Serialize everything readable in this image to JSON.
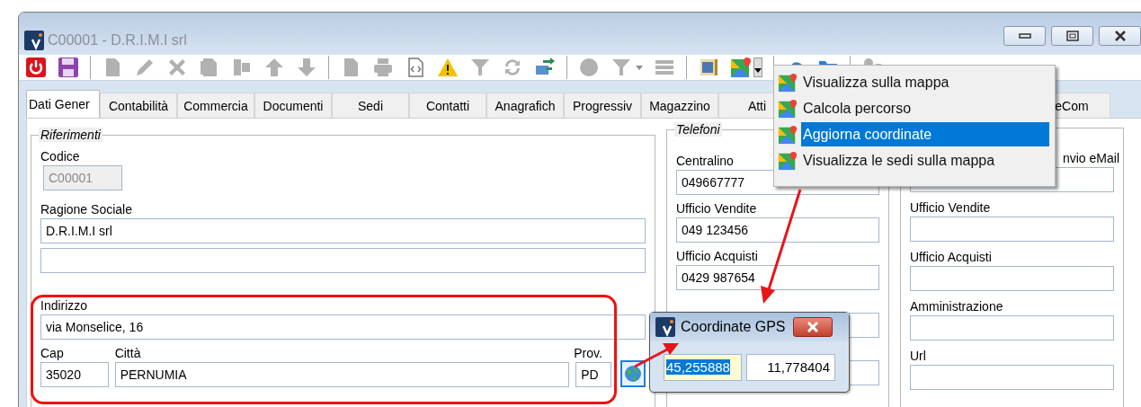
{
  "window": {
    "title": "C00001 - D.R.I.M.I srl"
  },
  "toolbar": [
    {
      "kind": "power",
      "disabled": false
    },
    {
      "kind": "floppy",
      "disabled": false
    },
    {
      "kind": "separator"
    },
    {
      "kind": "page",
      "disabled": true
    },
    {
      "kind": "pencil",
      "disabled": true
    },
    {
      "kind": "cross",
      "disabled": true
    },
    {
      "kind": "pages",
      "disabled": true
    },
    {
      "kind": "blocks",
      "disabled": true
    },
    {
      "kind": "arrow-up",
      "disabled": true
    },
    {
      "kind": "arrow-down",
      "disabled": true
    },
    {
      "kind": "separator"
    },
    {
      "kind": "page",
      "disabled": true
    },
    {
      "kind": "printer",
      "disabled": true
    },
    {
      "kind": "code-page",
      "disabled": false
    },
    {
      "kind": "warning",
      "disabled": false
    },
    {
      "kind": "funnel",
      "disabled": true
    },
    {
      "kind": "refresh",
      "disabled": true
    },
    {
      "kind": "transfer",
      "disabled": false
    },
    {
      "kind": "separator"
    },
    {
      "kind": "circle",
      "disabled": true
    },
    {
      "kind": "funnel-dropdown",
      "disabled": true
    },
    {
      "kind": "stack",
      "disabled": true
    },
    {
      "kind": "separator"
    },
    {
      "kind": "calendar",
      "disabled": false
    },
    {
      "kind": "map",
      "disabled": false
    },
    {
      "kind": "caret",
      "disabled": false
    },
    {
      "kind": "separator"
    },
    {
      "kind": "cloud",
      "disabled": false
    },
    {
      "kind": "folder",
      "disabled": false
    },
    {
      "kind": "separator"
    },
    {
      "kind": "person",
      "disabled": true
    }
  ],
  "tabs": [
    {
      "label": "Dati Gener",
      "selected": true
    },
    {
      "label": "Contabilità",
      "selected": false
    },
    {
      "label": "Commercia",
      "selected": false
    },
    {
      "label": "Documenti",
      "selected": false
    },
    {
      "label": "Sedi",
      "selected": false
    },
    {
      "label": "Contatti",
      "selected": false
    },
    {
      "label": "Anagrafich",
      "selected": false
    },
    {
      "label": "Progressiv",
      "selected": false
    },
    {
      "label": "Magazzino",
      "selected": false
    },
    {
      "label": "Atti",
      "selected": false
    },
    {
      "label": "eCom",
      "selected": false
    }
  ],
  "riferimenti": {
    "legend": "Riferimenti",
    "codice": {
      "label": "Codice",
      "value": "C00001",
      "disabled": true
    },
    "ragione_sociale": {
      "label": "Ragione Sociale",
      "value": "D.R.I.M.I srl"
    },
    "indirizzo": {
      "label": "Indirizzo",
      "value": "via Monselice, 16"
    },
    "cap": {
      "label": "Cap",
      "value": "35020"
    },
    "citta": {
      "label": "Città",
      "value": "PERNUMIA"
    },
    "prov": {
      "label": "Prov.",
      "value": "PD"
    }
  },
  "telefoni": {
    "legend": "Telefoni",
    "fields": [
      {
        "label": "Centralino",
        "value": "049667777"
      },
      {
        "label": "Ufficio Vendite",
        "value": "049 123456"
      },
      {
        "label": "Ufficio Acquisti",
        "value": "0429 987654"
      }
    ]
  },
  "email": {
    "label": "nvio eMail",
    "fields": [
      {
        "label": "Ufficio Vendite"
      },
      {
        "label": "Ufficio Acquisti"
      },
      {
        "label": "Amministrazione"
      },
      {
        "label": "Url"
      }
    ]
  },
  "menu": {
    "items": [
      {
        "label": "Visualizza sulla mappa",
        "selected": false
      },
      {
        "label": "Calcola percorso",
        "selected": false
      },
      {
        "label": "Aggiorna coordinate",
        "selected": true
      },
      {
        "label": "Visualizza le sedi sulla mappa",
        "selected": false
      }
    ]
  },
  "gps_dialog": {
    "title": "Coordinate GPS",
    "latitude": {
      "value": "45,255888",
      "selected": true
    },
    "longitude": {
      "value": "11,778404"
    }
  }
}
